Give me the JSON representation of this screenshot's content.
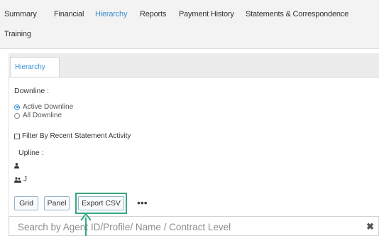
{
  "nav": {
    "tabs": [
      {
        "label": "Summary"
      },
      {
        "label": "Financial"
      },
      {
        "label": "Hierarchy"
      },
      {
        "label": "Reports"
      },
      {
        "label": "Payment History"
      },
      {
        "label": "Statements & Correspondence"
      },
      {
        "label": "Training"
      }
    ],
    "active_tab": "Hierarchy"
  },
  "subtab": {
    "label": "Hierarchy"
  },
  "downline": {
    "label": "Downline :",
    "options": [
      {
        "label": "Active Downline",
        "checked": true
      },
      {
        "label": "All Downline",
        "checked": false
      }
    ]
  },
  "filter": {
    "label": "Filter By Recent Statement Activity",
    "checked": false
  },
  "upline": {
    "label": "Upline :",
    "entries": [
      {
        "icon": "person-icon",
        "text": ""
      },
      {
        "icon": "people-icon",
        "text": "J"
      }
    ]
  },
  "toolbar": {
    "grid_label": "Grid",
    "panel_label": "Panel",
    "export_label": "Export CSV",
    "more_label": "•••"
  },
  "search": {
    "placeholder": "Search by Agent ID/Profile/ Name / Contract Level",
    "value": ""
  },
  "colors": {
    "accent": "#3a8fd3",
    "highlight": "#38a77f"
  }
}
